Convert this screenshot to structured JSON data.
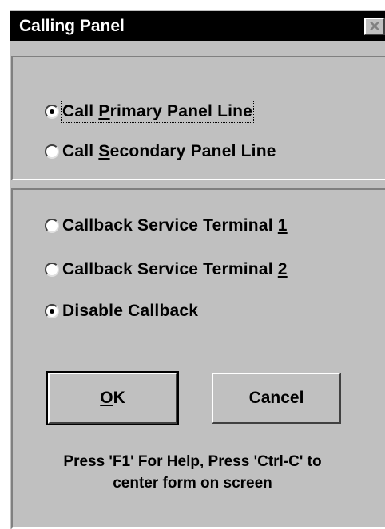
{
  "window": {
    "title": "Calling Panel",
    "close_glyph": "✕"
  },
  "panel_line": {
    "options": [
      {
        "pre": "Call ",
        "key": "P",
        "post": "rimary Panel Line",
        "selected": true
      },
      {
        "pre": "Call ",
        "key": "S",
        "post": "econdary Panel Line",
        "selected": false
      }
    ]
  },
  "callback": {
    "options": [
      {
        "pre": "Callback Service Terminal ",
        "key": "1",
        "post": "",
        "selected": false
      },
      {
        "pre": "Callback Service Terminal ",
        "key": "2",
        "post": "",
        "selected": false
      },
      {
        "pre": "Disable Callback",
        "key": "",
        "post": "",
        "selected": true
      }
    ]
  },
  "buttons": {
    "ok": {
      "key": "O",
      "rest": "K"
    },
    "cancel": "Cancel"
  },
  "help": {
    "line1": "Press 'F1' For Help, Press 'Ctrl-C' to",
    "line2": "center form on screen"
  },
  "icons": {
    "radio_checked": "radio-selected-icon",
    "radio_unchecked": "radio-unselected-icon"
  }
}
